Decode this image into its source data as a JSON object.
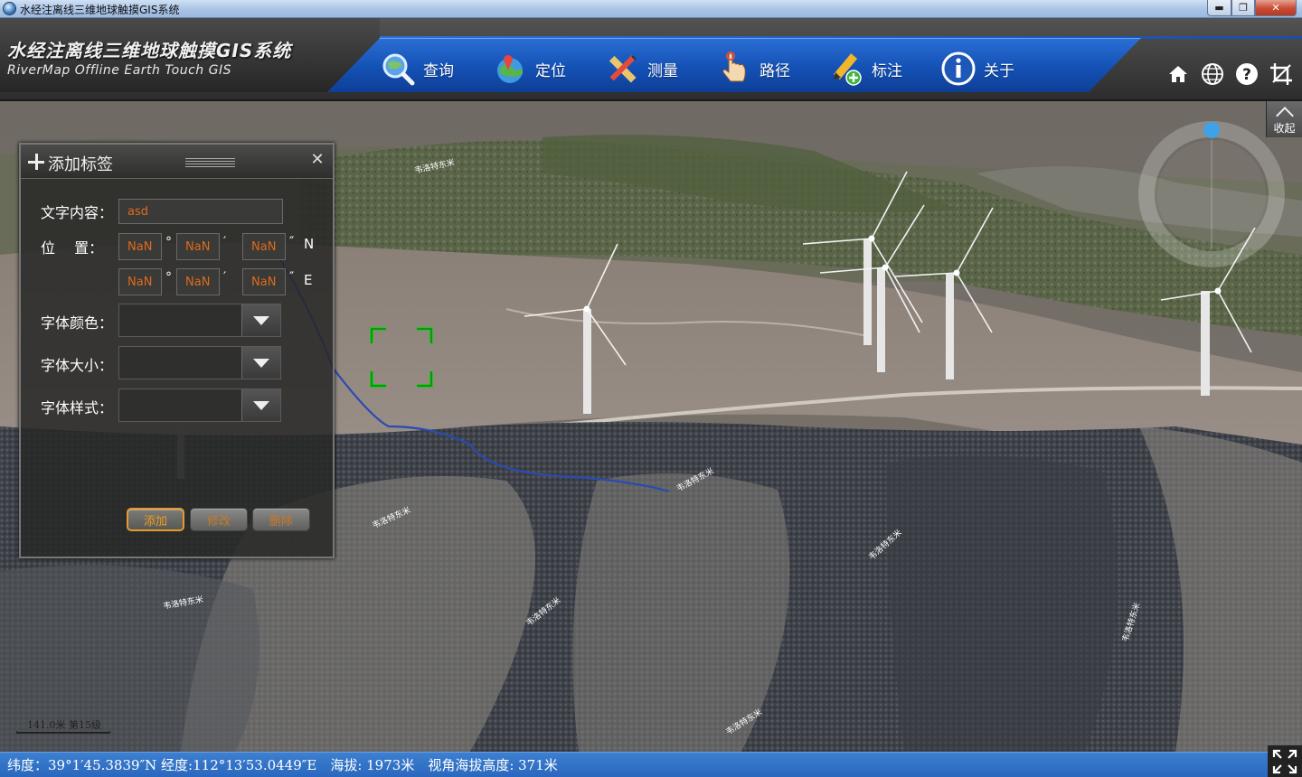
{
  "window": {
    "title": "水经注离线三维地球触摸GIS系统",
    "min_label": "▬",
    "max_label": "❐",
    "close_label": "✕"
  },
  "header": {
    "title_cn": "水经注离线三维地球触摸GIS系统",
    "title_en": "RiverMap Offline Earth Touch GIS",
    "nav": [
      {
        "label": "查询",
        "icon": "magnifier-globe-icon"
      },
      {
        "label": "定位",
        "icon": "locate-globe-icon"
      },
      {
        "label": "测量",
        "icon": "ruler-pencil-icon"
      },
      {
        "label": "路径",
        "icon": "hand-pointer-icon"
      },
      {
        "label": "标注",
        "icon": "pencil-add-icon"
      },
      {
        "label": "关于",
        "icon": "info-icon"
      }
    ],
    "tools": [
      "home-icon",
      "globe-icon",
      "help-icon",
      "crop-icon"
    ]
  },
  "collapse": {
    "label": "收起"
  },
  "panel": {
    "title": "添加标签",
    "text_label": "文字内容：",
    "text_value": "asd",
    "position_label": "位　 置：",
    "lat": {
      "deg": "NaN",
      "min": "NaN",
      "sec": "NaN",
      "hemi": "N"
    },
    "lon": {
      "deg": "NaN",
      "min": "NaN",
      "sec": "NaN",
      "hemi": "E"
    },
    "deg_symbol": "°",
    "min_symbol": "′",
    "sec_symbol": "″",
    "font_color_label": "字体颜色：",
    "font_size_label": "字体大小：",
    "font_style_label": "字体样式：",
    "font_color_value": "",
    "font_size_value": "",
    "font_style_value": "",
    "add_label": "添加",
    "modify_label": "修改",
    "delete_label": "删除"
  },
  "map": {
    "scale_text": "141.0米 第15级",
    "labels": [
      "韦洛特东米",
      "韦洛特东米",
      "韦洛特东米",
      "韦洛特东米",
      "韦洛特东米",
      "韦洛特东米",
      "韦洛特东米",
      "韦洛特东米"
    ]
  },
  "status": {
    "text": "纬度：39°1′45.3839″N 经度:112°13′53.0449″E　海拔: 1973米　视角海拔高度: 371米"
  },
  "colors": {
    "nav_blue": "#1451b5",
    "status_blue": "#2a68bd",
    "accent_orange": "#e59a2a",
    "input_text": "#e06a1c",
    "focus_green": "#1ec81e"
  }
}
